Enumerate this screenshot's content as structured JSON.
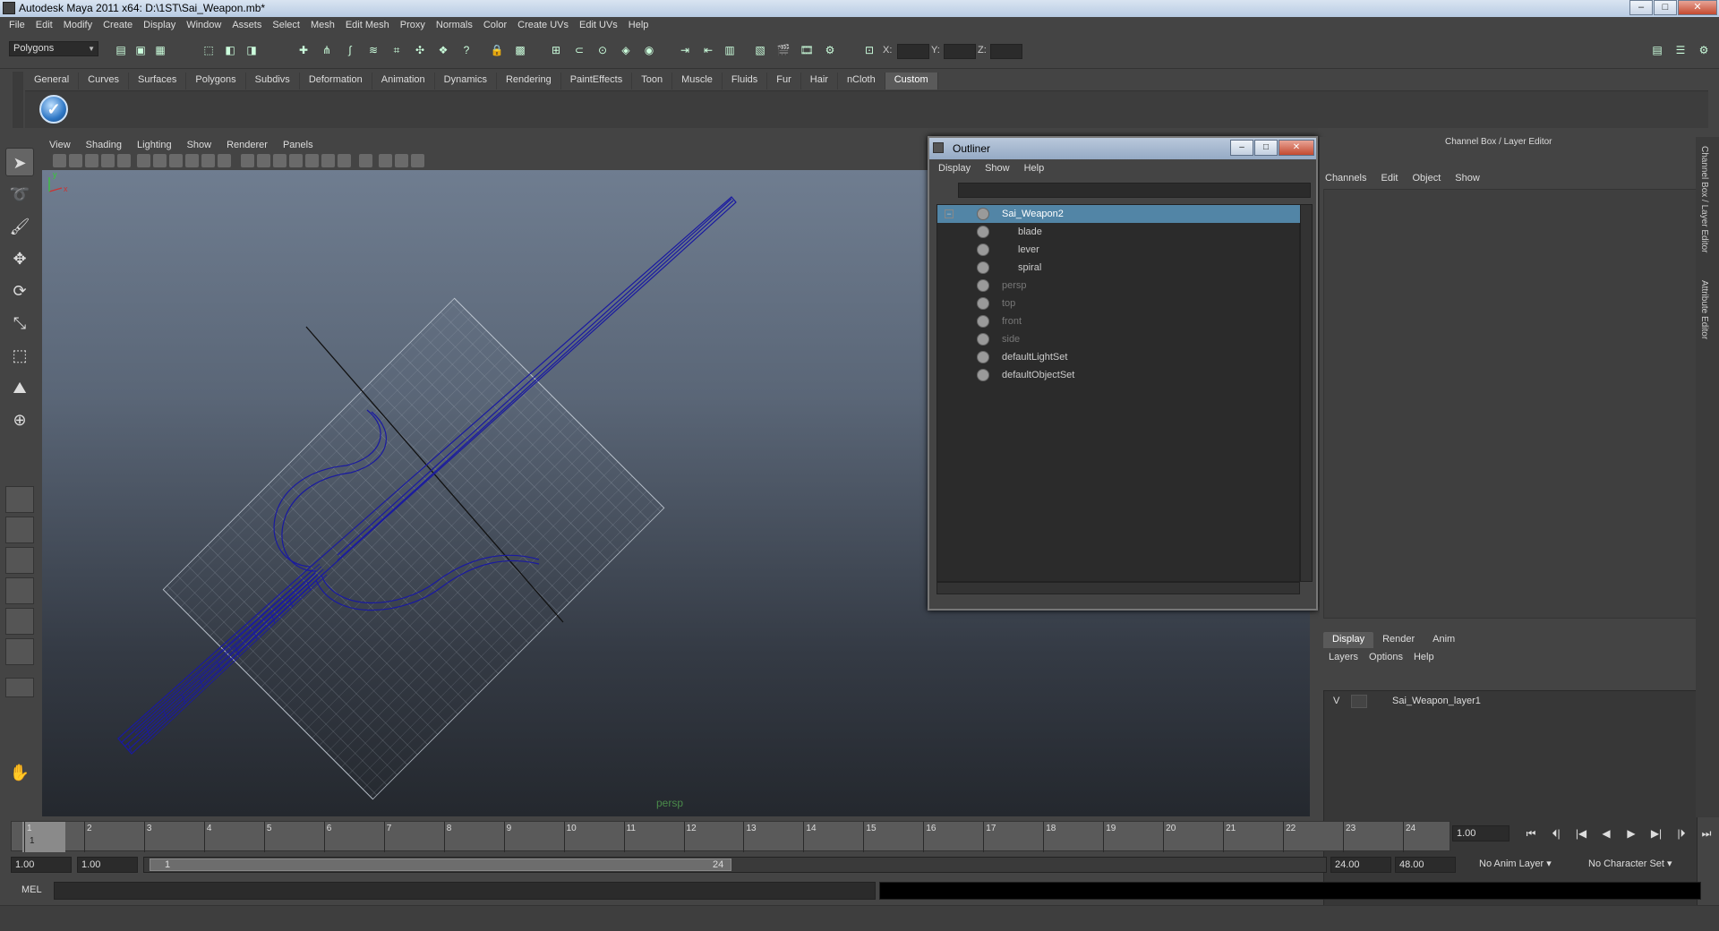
{
  "window": {
    "title": "Autodesk Maya 2011 x64: D:\\1ST\\Sai_Weapon.mb*",
    "min_label": "–",
    "max_label": "□",
    "close_label": "✕"
  },
  "menu": [
    "File",
    "Edit",
    "Modify",
    "Create",
    "Display",
    "Window",
    "Assets",
    "Select",
    "Mesh",
    "Edit Mesh",
    "Proxy",
    "Normals",
    "Color",
    "Create UVs",
    "Edit UVs",
    "Help"
  ],
  "statusline": {
    "mode": "Polygons",
    "x_label": "X:",
    "y_label": "Y:",
    "z_label": "Z:"
  },
  "shelf": {
    "tabs": [
      "General",
      "Curves",
      "Surfaces",
      "Polygons",
      "Subdivs",
      "Deformation",
      "Animation",
      "Dynamics",
      "Rendering",
      "PaintEffects",
      "Toon",
      "Muscle",
      "Fluids",
      "Fur",
      "Hair",
      "nCloth",
      "Custom"
    ],
    "active_tab": "Custom",
    "icon": "checkmark-shelf-icon"
  },
  "viewport": {
    "menu": [
      "View",
      "Shading",
      "Lighting",
      "Show",
      "Renderer",
      "Panels"
    ],
    "camera_label": "persp",
    "wire_color": "#1a1aa0"
  },
  "outliner": {
    "title": "Outliner",
    "menu": [
      "Display",
      "Show",
      "Help"
    ],
    "items": [
      {
        "name": "Sai_Weapon2",
        "level": 0,
        "selected": true,
        "dim": false,
        "expand": "−"
      },
      {
        "name": "blade",
        "level": 1,
        "selected": false,
        "dim": false
      },
      {
        "name": "lever",
        "level": 1,
        "selected": false,
        "dim": false
      },
      {
        "name": "spiral",
        "level": 1,
        "selected": false,
        "dim": false
      },
      {
        "name": "persp",
        "level": 0,
        "selected": false,
        "dim": true
      },
      {
        "name": "top",
        "level": 0,
        "selected": false,
        "dim": true
      },
      {
        "name": "front",
        "level": 0,
        "selected": false,
        "dim": true
      },
      {
        "name": "side",
        "level": 0,
        "selected": false,
        "dim": true
      },
      {
        "name": "defaultLightSet",
        "level": 0,
        "selected": false,
        "dim": false
      },
      {
        "name": "defaultObjectSet",
        "level": 0,
        "selected": false,
        "dim": false
      }
    ]
  },
  "channelbox": {
    "title": "Channel Box / Layer Editor",
    "menu": [
      "Channels",
      "Edit",
      "Object",
      "Show"
    ],
    "tabs": [
      "Display",
      "Render",
      "Anim"
    ],
    "active_tab": "Display",
    "layer_menu": [
      "Layers",
      "Options",
      "Help"
    ],
    "layer": {
      "visible": "V",
      "name": "Sai_Weapon_layer1"
    },
    "side_tabs": [
      "Channel Box / Layer Editor",
      "Attribute Editor"
    ]
  },
  "timeline": {
    "start": 1,
    "end": 24,
    "current_frame": "1",
    "current_time": "1.00"
  },
  "range": {
    "start_time": "1.00",
    "playback_start": "1.00",
    "range_start_label": "1",
    "range_end_label": "24",
    "playback_end": "24.00",
    "end_time": "48.00",
    "anim_layer": "No Anim Layer",
    "character_set": "No Character Set"
  },
  "playback": [
    "⏮",
    "⏴|",
    "|◀",
    "◀",
    "▶",
    "▶|",
    "|⏵",
    "⏭"
  ],
  "cmdline": {
    "label": "MEL"
  }
}
